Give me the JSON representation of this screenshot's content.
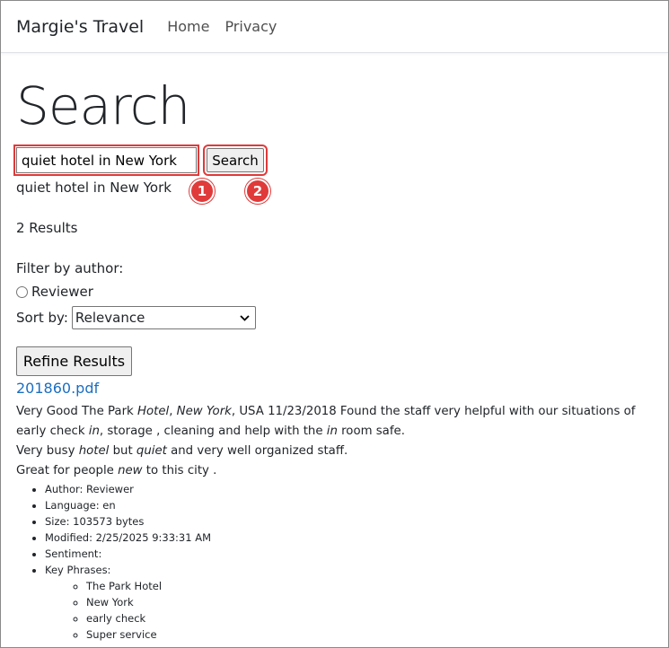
{
  "navbar": {
    "brand": "Margie's Travel",
    "links": [
      "Home",
      "Privacy"
    ]
  },
  "page": {
    "title": "Search",
    "search": {
      "value": "quiet hotel in New York",
      "button_label": "Search"
    },
    "query_echo": "quiet hotel in New York",
    "result_count": "2 Results",
    "filter": {
      "label": "Filter by author:",
      "option": "Reviewer"
    },
    "sort": {
      "label": "Sort by:",
      "selected": "Relevance"
    },
    "refine_label": "Refine Results"
  },
  "annotations": [
    "1",
    "2"
  ],
  "result": {
    "title": "201860.pdf",
    "snippet": {
      "line1_a": "Very Good The Park ",
      "line1_b": "Hotel",
      "line1_c": ", ",
      "line1_d": "New York",
      "line1_e": ", USA 11/23/2018 Found the staff very helpful with our situations of early check ",
      "line1_f": "in",
      "line1_g": ", storage , cleaning and help with the ",
      "line1_h": "in",
      "line1_i": " room safe.",
      "line2_a": "Very busy ",
      "line2_b": "hotel",
      "line2_c": " but ",
      "line2_d": "quiet",
      "line2_e": " and very well organized staff.",
      "line3_a": "Great for people ",
      "line3_b": "new",
      "line3_c": " to this city ."
    },
    "metadata": {
      "author": "Author: Reviewer",
      "language": "Language: en",
      "size": "Size: 103573 bytes",
      "modified": "Modified: 2/25/2025 9:33:31 AM",
      "sentiment": "Sentiment:",
      "key_phrases_label": "Key Phrases:",
      "key_phrases": [
        "The Park Hotel",
        "New York",
        "early check",
        "Super service"
      ]
    }
  }
}
